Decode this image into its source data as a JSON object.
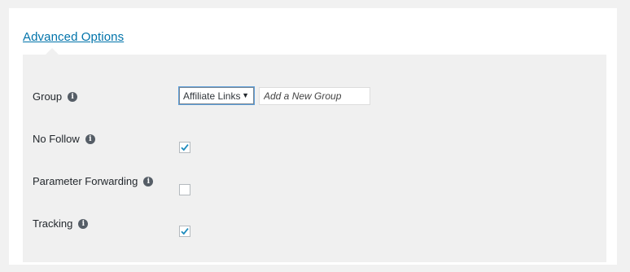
{
  "section": {
    "title": "Advanced Options"
  },
  "fields": {
    "group": {
      "label": "Group",
      "select_value": "Affiliate Links",
      "new_group_placeholder": "Add a New Group"
    },
    "no_follow": {
      "label": "No Follow",
      "checked": true
    },
    "parameter_forwarding": {
      "label": "Parameter Forwarding",
      "checked": false
    },
    "tracking": {
      "label": "Tracking",
      "checked": true
    }
  },
  "icons": {
    "info": "i",
    "select_arrow": "▼"
  },
  "colors": {
    "link": "#0073aa",
    "checkmark": "#1e8cbe",
    "panel": "#f0f0f0"
  }
}
